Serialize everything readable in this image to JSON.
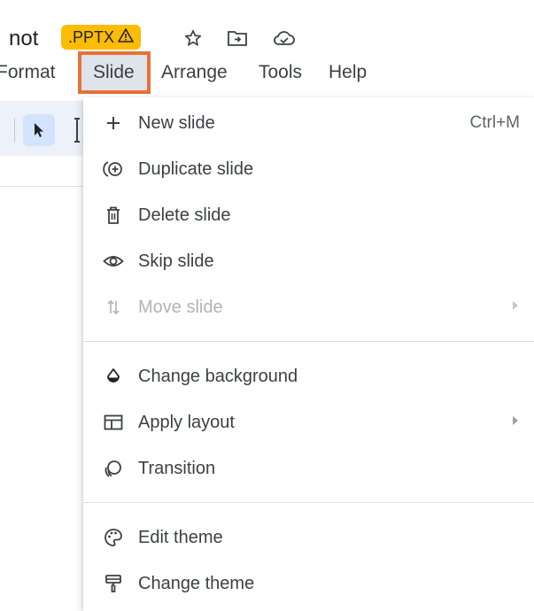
{
  "header": {
    "title_fragment": "not",
    "badge_label": ".PPTX",
    "badge_icon": "warning-icon",
    "icons": [
      "star-icon",
      "move-to-folder-icon",
      "cloud-status-icon"
    ]
  },
  "menubar": {
    "items": [
      {
        "label": "Format"
      },
      {
        "label": "Slide",
        "active": true
      },
      {
        "label": "Arrange"
      },
      {
        "label": "Tools"
      },
      {
        "label": "Help"
      }
    ]
  },
  "toolbar": {
    "icons": [
      "select-cursor-icon",
      "text-box-icon"
    ]
  },
  "dropdown": {
    "items": [
      {
        "label": "New slide",
        "icon": "plus-icon",
        "shortcut": "Ctrl+M"
      },
      {
        "label": "Duplicate slide",
        "icon": "duplicate-icon"
      },
      {
        "label": "Delete slide",
        "icon": "trash-icon"
      },
      {
        "label": "Skip slide",
        "icon": "eye-icon"
      },
      {
        "label": "Move slide",
        "icon": "move-arrows-icon",
        "disabled": true,
        "submenu": true
      },
      {
        "label": "Change background",
        "icon": "fill-drop-icon"
      },
      {
        "label": "Apply layout",
        "icon": "layout-icon",
        "submenu": true
      },
      {
        "label": "Transition",
        "icon": "transition-icon"
      },
      {
        "label": "Edit theme",
        "icon": "palette-icon"
      },
      {
        "label": "Change theme",
        "icon": "paint-roller-icon"
      }
    ]
  },
  "colors": {
    "active_highlight_border": "#e8703a",
    "badge_bg": "#fbbc04",
    "selected_tool_bg": "#d3e3fd"
  }
}
